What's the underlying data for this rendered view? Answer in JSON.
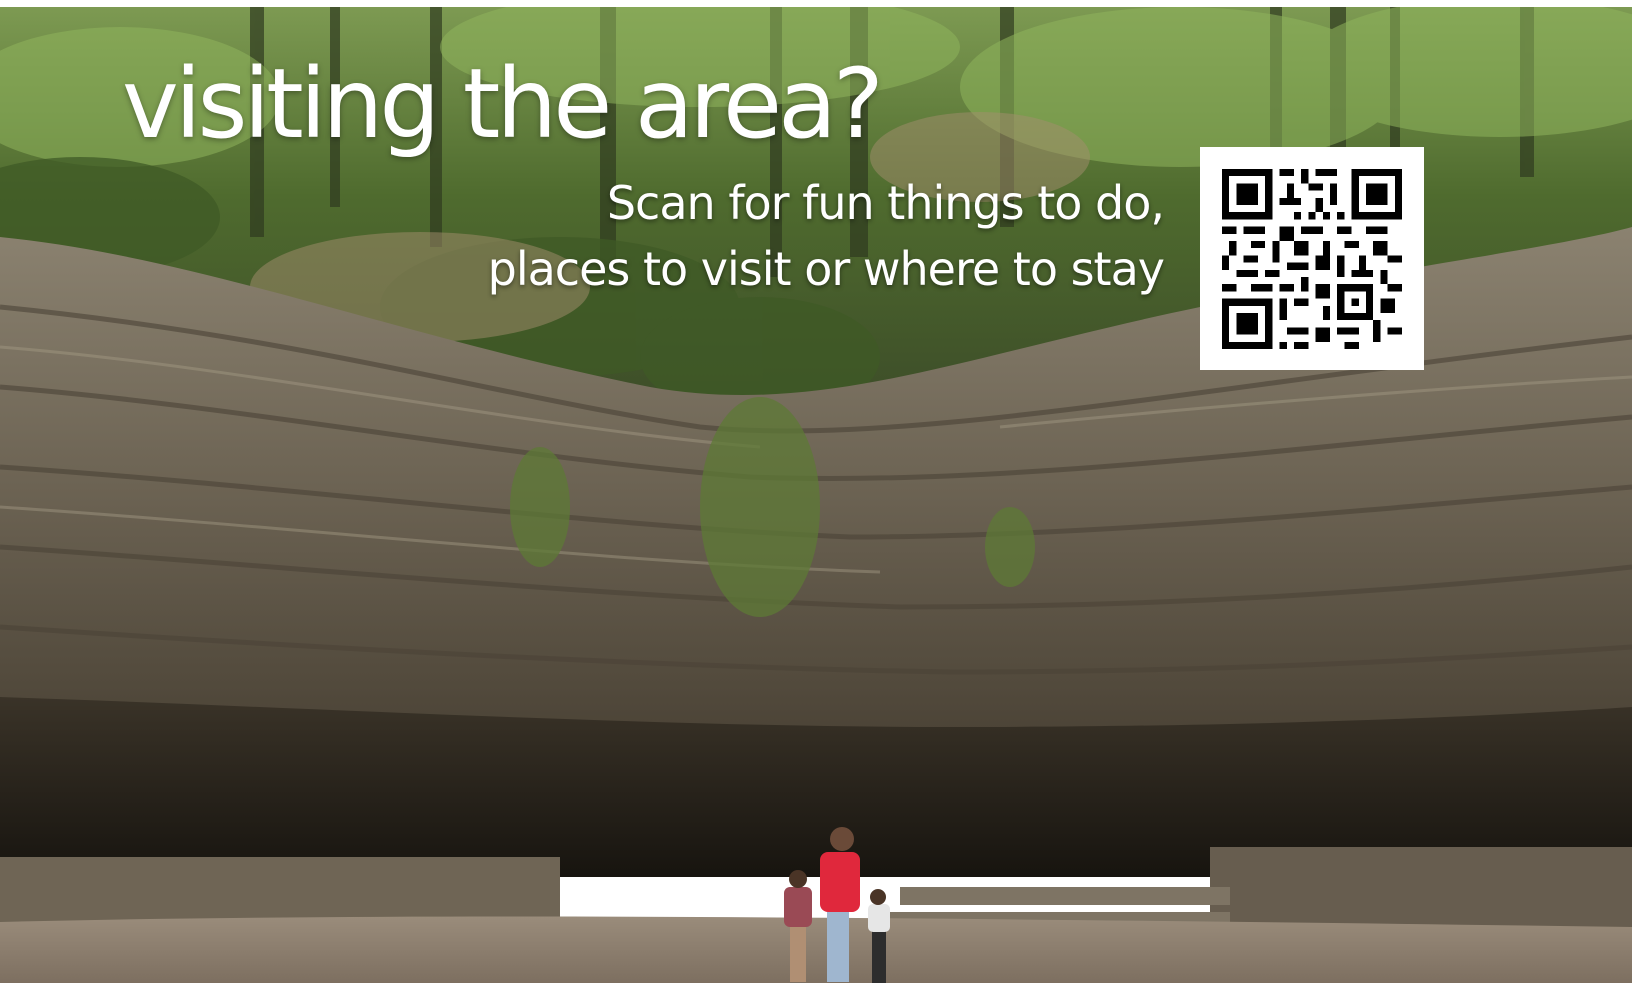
{
  "poster": {
    "headline": "visiting the area?",
    "subtext_lines": [
      "Scan for fun things to do,",
      "places to visit or where to stay"
    ]
  },
  "colors": {
    "text": "#ffffff",
    "foliage": "#4f6b2e",
    "rock": "#6c6353",
    "cave_shadow": "#1f1b15",
    "ground": "#8a7c6c",
    "person_jacket": "#e0283c"
  },
  "icons": {
    "qr": "qr-code-icon"
  }
}
